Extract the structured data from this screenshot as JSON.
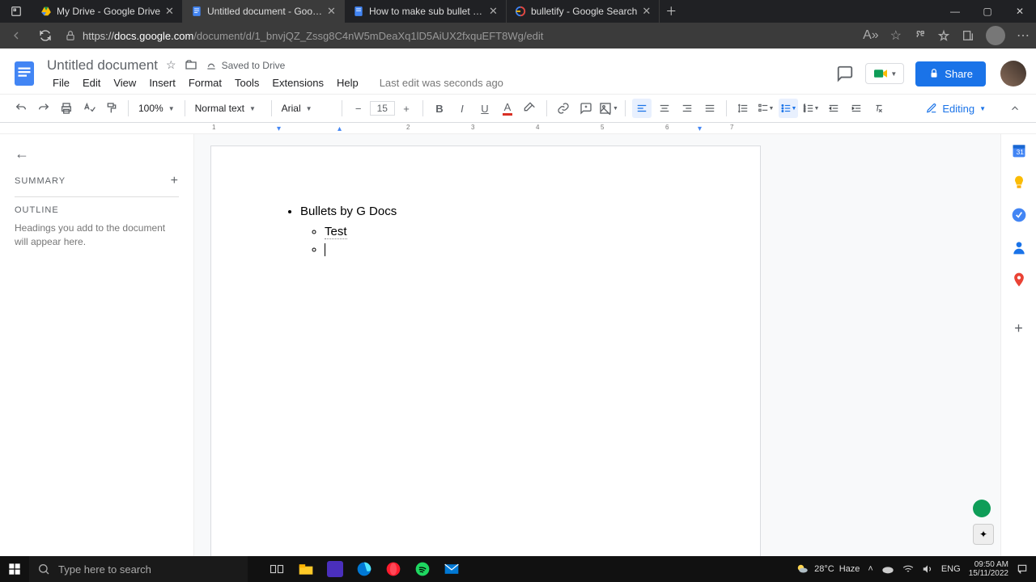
{
  "browser": {
    "tabs": [
      {
        "title": "My Drive - Google Drive"
      },
      {
        "title": "Untitled document - Google Docs"
      },
      {
        "title": "How to make sub bullet points in"
      },
      {
        "title": "bulletify - Google Search"
      }
    ],
    "url_domain": "docs.google.com",
    "url_path": "/document/d/1_bnvjQZ_Zssg8C4nW5mDeaXq1lD5AiUX2fxquEFT8Wg/edit"
  },
  "docs": {
    "title": "Untitled document",
    "saved_status": "Saved to Drive",
    "menu": [
      "File",
      "Edit",
      "View",
      "Insert",
      "Format",
      "Tools",
      "Extensions",
      "Help"
    ],
    "last_edit": "Last edit was seconds ago",
    "share_label": "Share",
    "toolbar": {
      "zoom": "100%",
      "style": "Normal text",
      "font": "Arial",
      "font_size": "15",
      "editing": "Editing"
    },
    "outline": {
      "summary": "SUMMARY",
      "outline": "OUTLINE",
      "placeholder": "Headings you add to the document will appear here."
    },
    "content": {
      "line1": "Bullets by G Docs",
      "line2": "Test"
    },
    "ruler_marks": [
      "1",
      "2",
      "3",
      "4",
      "5",
      "6",
      "7"
    ]
  },
  "taskbar": {
    "search_placeholder": "Type here to search",
    "weather_temp": "28°C",
    "weather_cond": "Haze",
    "lang": "ENG",
    "time": "09:50 AM",
    "date": "15/11/2022"
  }
}
